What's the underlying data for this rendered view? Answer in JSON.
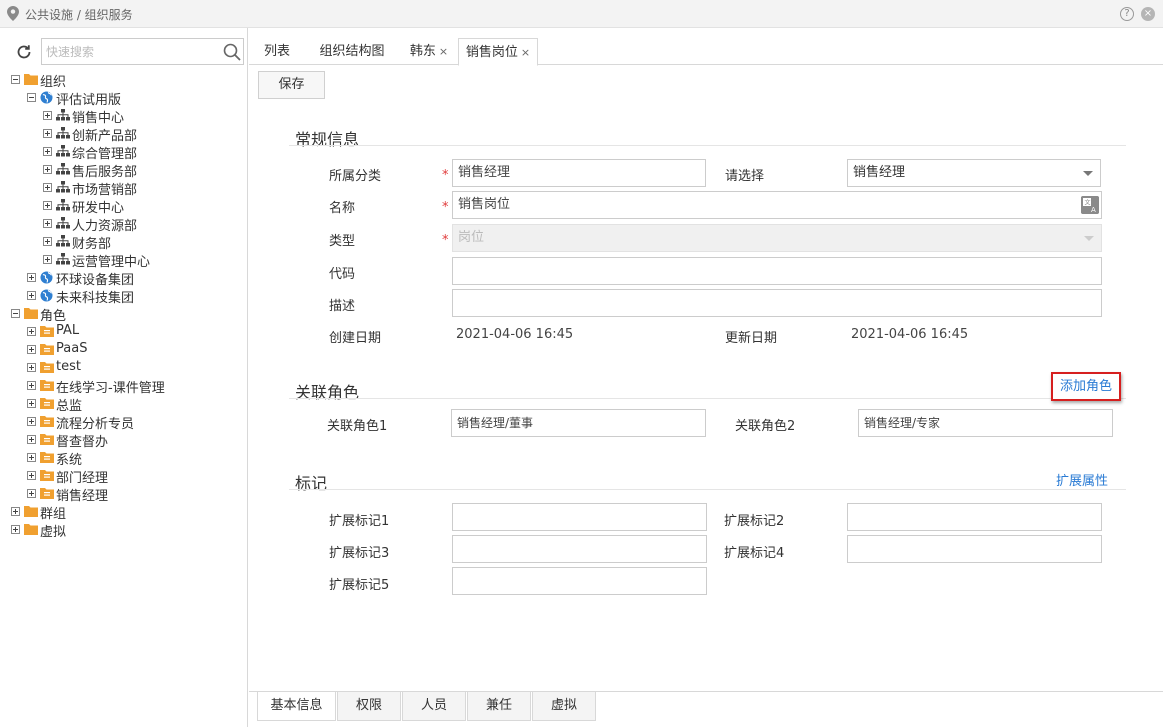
{
  "breadcrumb": "公共设施 / 组织服务",
  "topbar": {
    "help": "?",
    "close": "×"
  },
  "sidebar": {
    "search_placeholder": "快速搜索",
    "tree": [
      {
        "label": "组织",
        "level": 0,
        "icon": "folder",
        "toggle": "minus"
      },
      {
        "label": "评估试用版",
        "level": 1,
        "icon": "globe",
        "toggle": "minus"
      },
      {
        "label": "销售中心",
        "level": 2,
        "icon": "org",
        "toggle": "plus"
      },
      {
        "label": "创新产品部",
        "level": 2,
        "icon": "org",
        "toggle": "plus"
      },
      {
        "label": "综合管理部",
        "level": 2,
        "icon": "org",
        "toggle": "plus"
      },
      {
        "label": "售后服务部",
        "level": 2,
        "icon": "org",
        "toggle": "plus"
      },
      {
        "label": "市场营销部",
        "level": 2,
        "icon": "org",
        "toggle": "plus"
      },
      {
        "label": "研发中心",
        "level": 2,
        "icon": "org",
        "toggle": "plus"
      },
      {
        "label": "人力资源部",
        "level": 2,
        "icon": "org",
        "toggle": "plus"
      },
      {
        "label": "财务部",
        "level": 2,
        "icon": "org",
        "toggle": "plus"
      },
      {
        "label": "运营管理中心",
        "level": 2,
        "icon": "org",
        "toggle": "plus"
      },
      {
        "label": "环球设备集团",
        "level": 1,
        "icon": "globe",
        "toggle": "plus"
      },
      {
        "label": "未来科技集团",
        "level": 1,
        "icon": "globe",
        "toggle": "plus"
      },
      {
        "label": "角色",
        "level": 0,
        "icon": "folder",
        "toggle": "minus"
      },
      {
        "label": "PAL",
        "level": 1,
        "icon": "rolefolder",
        "toggle": "plus"
      },
      {
        "label": "PaaS",
        "level": 1,
        "icon": "rolefolder",
        "toggle": "plus"
      },
      {
        "label": "test",
        "level": 1,
        "icon": "rolefolder",
        "toggle": "plus"
      },
      {
        "label": "在线学习-课件管理",
        "level": 1,
        "icon": "rolefolder",
        "toggle": "plus"
      },
      {
        "label": "总监",
        "level": 1,
        "icon": "rolefolder",
        "toggle": "plus"
      },
      {
        "label": "流程分析专员",
        "level": 1,
        "icon": "rolefolder",
        "toggle": "plus"
      },
      {
        "label": "督查督办",
        "level": 1,
        "icon": "rolefolder",
        "toggle": "plus"
      },
      {
        "label": "系统",
        "level": 1,
        "icon": "rolefolder",
        "toggle": "plus"
      },
      {
        "label": "部门经理",
        "level": 1,
        "icon": "rolefolder",
        "toggle": "plus"
      },
      {
        "label": "销售经理",
        "level": 1,
        "icon": "rolefolder",
        "toggle": "plus"
      },
      {
        "label": "群组",
        "level": 0,
        "icon": "folder",
        "toggle": "plus"
      },
      {
        "label": "虚拟",
        "level": 0,
        "icon": "folder",
        "toggle": "plus"
      }
    ]
  },
  "tabs": [
    {
      "label": "列表",
      "closable": false,
      "active": false
    },
    {
      "label": "组织结构图",
      "closable": false,
      "active": false
    },
    {
      "label": "韩东",
      "closable": true,
      "active": false
    },
    {
      "label": "销售岗位",
      "closable": true,
      "active": true
    }
  ],
  "tab_close": "×",
  "toolbar": {
    "save_label": "保存"
  },
  "general": {
    "title": "常规信息",
    "category_label": "所属分类",
    "category_value": "销售经理",
    "select_label": "请选择",
    "select_value": "销售经理",
    "name_label": "名称",
    "name_value": "销售岗位",
    "type_label": "类型",
    "type_value": "岗位",
    "code_label": "代码",
    "code_value": "",
    "desc_label": "描述",
    "desc_value": "",
    "created_label": "创建日期",
    "created_value": "2021-04-06 16:45",
    "updated_label": "更新日期",
    "updated_value": "2021-04-06 16:45",
    "required_mark": "*"
  },
  "roles": {
    "title": "关联角色",
    "add_label": "添加角色",
    "role1_label": "关联角色1",
    "role1_value": "销售经理/董事",
    "role2_label": "关联角色2",
    "role2_value": "销售经理/专家"
  },
  "marks": {
    "title": "标记",
    "ext_attr_label": "扩展属性",
    "items": [
      {
        "label": "扩展标记1",
        "value": ""
      },
      {
        "label": "扩展标记2",
        "value": ""
      },
      {
        "label": "扩展标记3",
        "value": ""
      },
      {
        "label": "扩展标记4",
        "value": ""
      },
      {
        "label": "扩展标记5",
        "value": ""
      }
    ]
  },
  "bottom_tabs": [
    {
      "label": "基本信息",
      "active": true
    },
    {
      "label": "权限",
      "active": false
    },
    {
      "label": "人员",
      "active": false
    },
    {
      "label": "兼任",
      "active": false
    },
    {
      "label": "虚拟",
      "active": false
    }
  ],
  "colors": {
    "accent": "#2a7bd4",
    "required": "#e03a3a",
    "highlight_border": "#d61f1f",
    "folder": "#f0a030",
    "globe": "#2f7fd1"
  }
}
